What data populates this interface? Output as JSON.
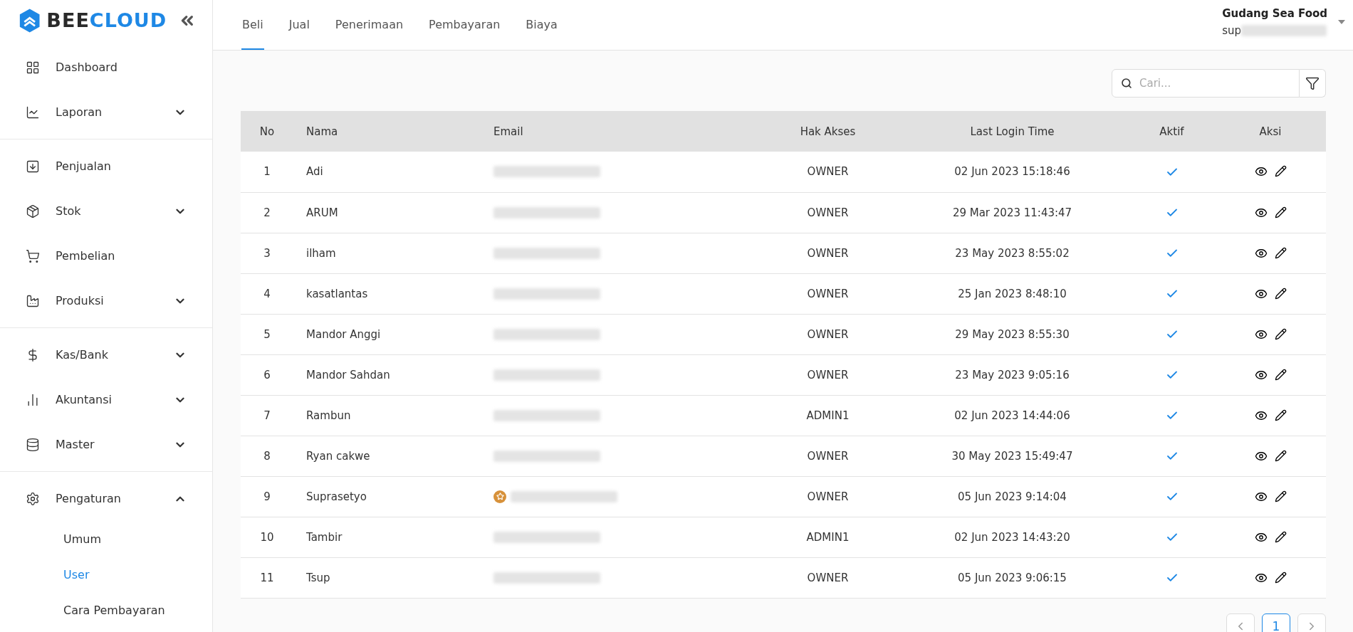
{
  "brand": {
    "part_1": "BEE",
    "part_2": "CLOUD"
  },
  "sidebar": {
    "groups": [
      {
        "items": [
          {
            "label": "Dashboard"
          },
          {
            "label": "Laporan",
            "expanded": false
          }
        ]
      },
      {
        "items": [
          {
            "label": "Penjualan"
          },
          {
            "label": "Stok",
            "expanded": false
          },
          {
            "label": "Pembelian"
          },
          {
            "label": "Produksi",
            "expanded": false
          }
        ]
      },
      {
        "items": [
          {
            "label": "Kas/Bank",
            "expanded": false
          },
          {
            "label": "Akuntansi",
            "expanded": false
          },
          {
            "label": "Master",
            "expanded": false
          }
        ]
      },
      {
        "items": [
          {
            "label": "Pengaturan",
            "expanded": true,
            "children": [
              {
                "label": "Umum",
                "selected": false
              },
              {
                "label": "User",
                "selected": true
              },
              {
                "label": "Cara Pembayaran",
                "selected": false
              }
            ]
          }
        ]
      }
    ]
  },
  "tabs": [
    {
      "label": "Beli",
      "selected": true
    },
    {
      "label": "Jual",
      "selected": false
    },
    {
      "label": "Penerimaan",
      "selected": false
    },
    {
      "label": "Pembayaran",
      "selected": false
    },
    {
      "label": "Biaya",
      "selected": false
    }
  ],
  "account": {
    "company": "Gudang Sea Food",
    "user_prefix": "sup"
  },
  "search": {
    "placeholder": "Cari..."
  },
  "table": {
    "columns": [
      "No",
      "Nama",
      "Email",
      "Hak Akses",
      "Last Login Time",
      "Aktif",
      "Aksi"
    ],
    "rows": [
      {
        "no": "1",
        "name": "Adi",
        "starred": false,
        "role": "OWNER",
        "last_login": "02 Jun 2023 15:18:46",
        "active": true
      },
      {
        "no": "2",
        "name": "ARUM",
        "starred": false,
        "role": "OWNER",
        "last_login": "29 Mar 2023 11:43:47",
        "active": true
      },
      {
        "no": "3",
        "name": "ilham",
        "starred": false,
        "role": "OWNER",
        "last_login": "23 May 2023 8:55:02",
        "active": true
      },
      {
        "no": "4",
        "name": "kasatlantas",
        "starred": false,
        "role": "OWNER",
        "last_login": "25 Jan 2023 8:48:10",
        "active": true
      },
      {
        "no": "5",
        "name": "Mandor Anggi",
        "starred": false,
        "role": "OWNER",
        "last_login": "29 May 2023 8:55:30",
        "active": true
      },
      {
        "no": "6",
        "name": "Mandor Sahdan",
        "starred": false,
        "role": "OWNER",
        "last_login": "23 May 2023 9:05:16",
        "active": true
      },
      {
        "no": "7",
        "name": "Rambun",
        "starred": false,
        "role": "ADMIN1",
        "last_login": "02 Jun 2023 14:44:06",
        "active": true
      },
      {
        "no": "8",
        "name": "Ryan cakwe",
        "starred": false,
        "role": "OWNER",
        "last_login": "30 May 2023 15:49:47",
        "active": true
      },
      {
        "no": "9",
        "name": "Suprasetyo",
        "starred": true,
        "role": "OWNER",
        "last_login": "05 Jun 2023 9:14:04",
        "active": true
      },
      {
        "no": "10",
        "name": "Tambir",
        "starred": false,
        "role": "ADMIN1",
        "last_login": "02 Jun 2023 14:43:20",
        "active": true
      },
      {
        "no": "11",
        "name": "Tsup",
        "starred": false,
        "role": "OWNER",
        "last_login": "05 Jun 2023 9:06:15",
        "active": true
      }
    ]
  },
  "pagination": {
    "pages": [
      {
        "label": "1",
        "selected": true
      }
    ]
  }
}
